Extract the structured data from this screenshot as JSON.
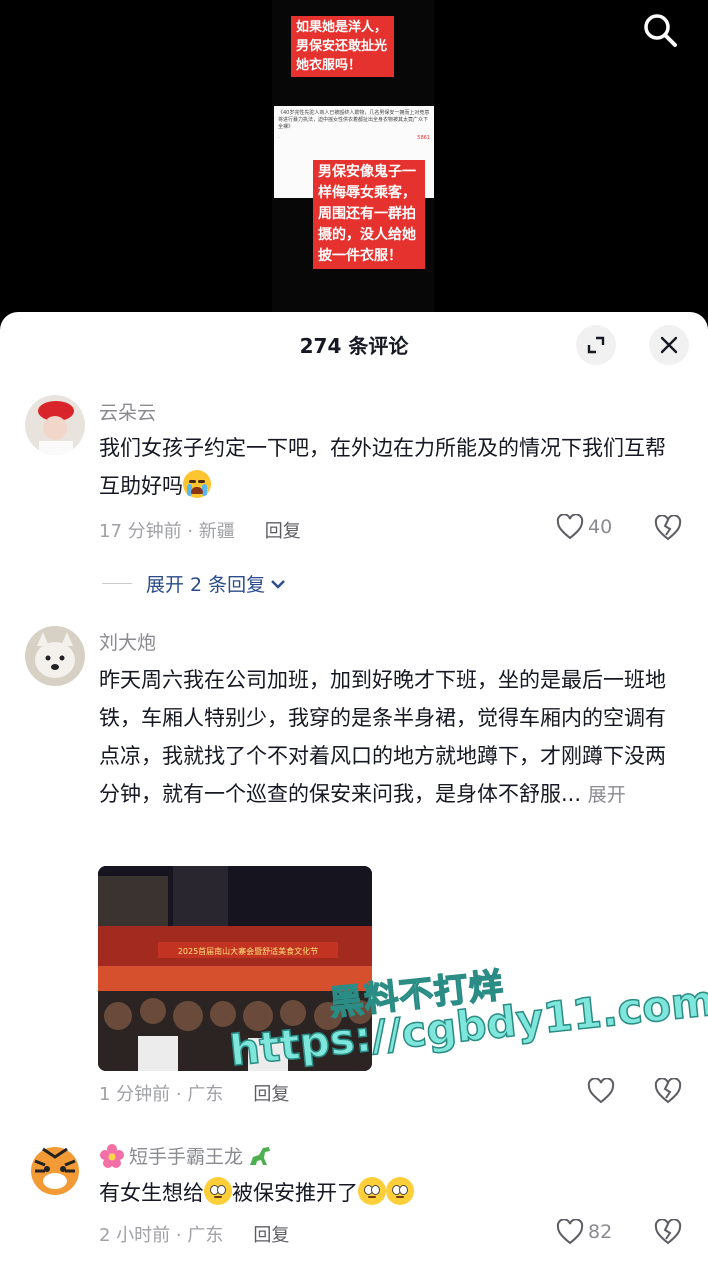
{
  "video": {
    "caption_top": "如果她是洋人，男保安还敢扯光她衣服吗！",
    "caption_mid": "男保安像鬼子一样侮辱女乘客，周围还有一群拍摄的，没人给她披一件衣服！",
    "screenshot_text": "《40岁完性先驼人商人已被殴终人欺物，几名男保安一拥而上对竞意将进行暴力执法，迫中摇女性供衣着都扯出全身衣物被其太竟广众下全裸》",
    "screenshot_count": "5861"
  },
  "panel": {
    "title": "274 条评论"
  },
  "comments": [
    {
      "name": "云朵云",
      "text": "我们女孩子约定一下吧，在外边在力所能及的情况下我们互帮互助好吗",
      "time_location": "17 分钟前 · 新疆",
      "reply_label": "回复",
      "likes": "40",
      "expand_replies": "展开 2 条回复"
    },
    {
      "name": "刘大炮",
      "text": "昨天周六我在公司加班，加到好晚才下班，坐的是最后一班地铁，车厢人特别少，我穿的是条半身裙，觉得车厢内的空调有点凉，我就找了个不对着风口的地方就地蹲下，才刚蹲下没两分钟，就有一个巡查的保安来问我，是身体不舒服...",
      "more_label": "展开",
      "photo_banner": "2025首届南山大寨会暨舒适美食文化节",
      "time_location": "1 分钟前 · 广东",
      "reply_label": "回复",
      "likes": ""
    },
    {
      "name": "短手手霸王龙",
      "text_part1": "有女生想给",
      "text_part2": "被保安推开了",
      "time_location": "2 小时前 · 广东",
      "reply_label": "回复",
      "likes": "82"
    }
  ],
  "watermark": {
    "line1": "黑料不打烊",
    "line2": "https://cgbdy11.com"
  },
  "colors": {
    "caption_red": "#e6322f",
    "link_blue": "#2b4c8c",
    "watermark": "#7fe6dc"
  },
  "icons": [
    "search-icon",
    "expand-icon",
    "close-icon",
    "heart-icon",
    "dislike-icon",
    "chevron-down-icon",
    "flower-icon",
    "dinosaur-icon"
  ]
}
